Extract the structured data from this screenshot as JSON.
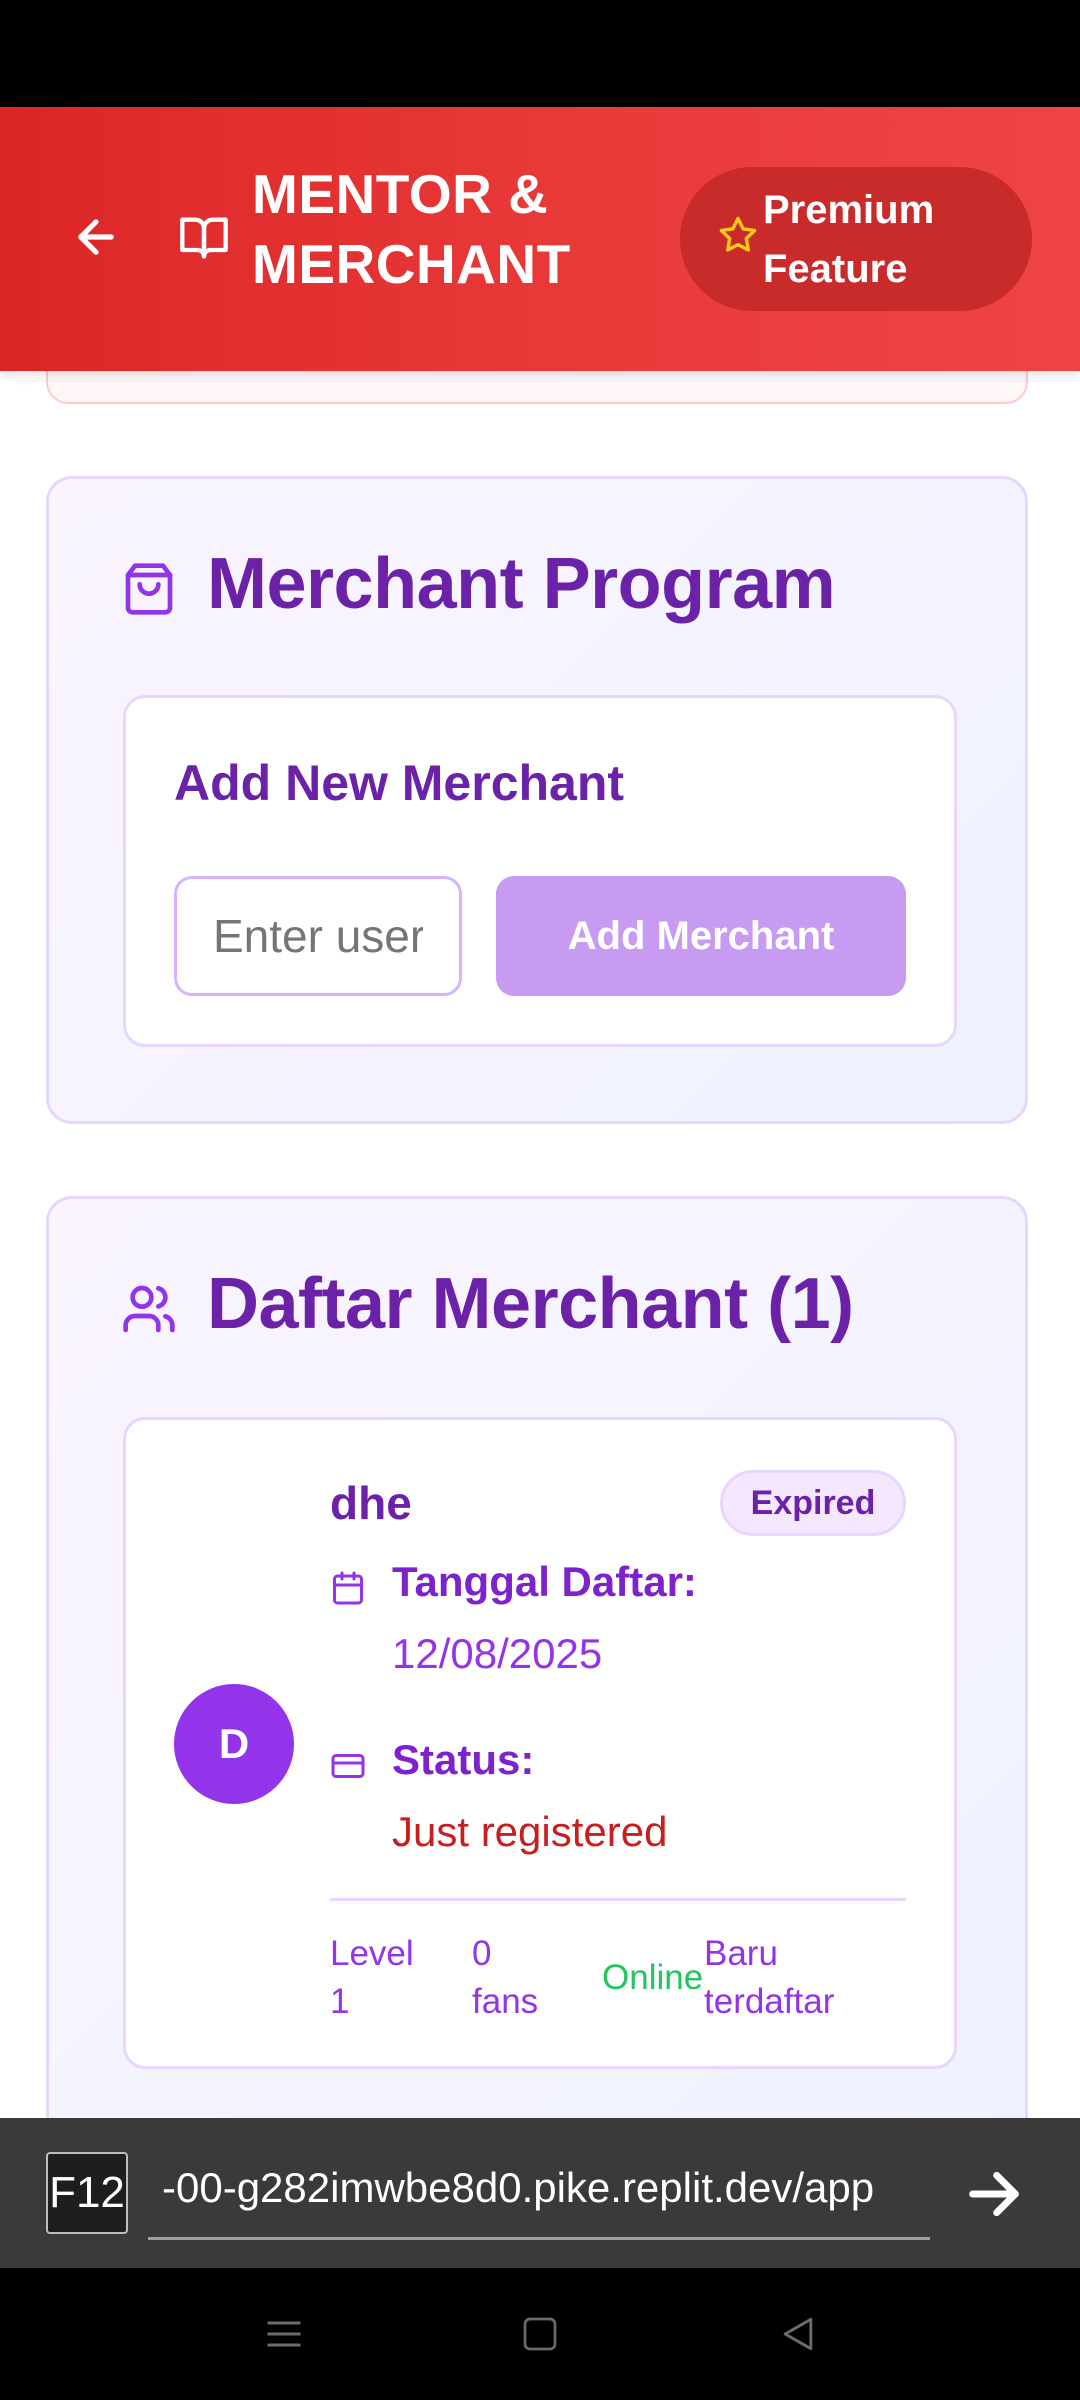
{
  "header": {
    "title_line1": "MENTOR &",
    "title_line2": "MERCHANT",
    "premium_line1": "Premium",
    "premium_line2": "Feature",
    "accent_color": "#dc2626"
  },
  "merchant_program": {
    "title": "Merchant Program",
    "add_title": "Add New Merchant",
    "input_placeholder": "Enter username",
    "add_button": "Add Merchant"
  },
  "merchant_list": {
    "title": "Daftar Merchant (1)",
    "items": [
      {
        "avatar_letter": "D",
        "name": "dhe",
        "badge": "Expired",
        "date_label": "Tanggal Daftar:",
        "date_value": "12/08/2025",
        "status_label": "Status:",
        "status_value": "Just registered",
        "stats": {
          "level_line1": "Level",
          "level_line2": "1",
          "fans_line1": "0",
          "fans_line2": "fans",
          "online": "Online",
          "new_line1": "Baru",
          "new_line2": "terdaftar"
        }
      }
    ]
  },
  "browser": {
    "f12_label": "F12",
    "url": "-00-g282imwbe8d0.pike.replit.dev/app"
  },
  "colors": {
    "purple_dark": "#6b21a8",
    "purple": "#9333ea",
    "green": "#22c55e",
    "red": "#c81e1e"
  }
}
